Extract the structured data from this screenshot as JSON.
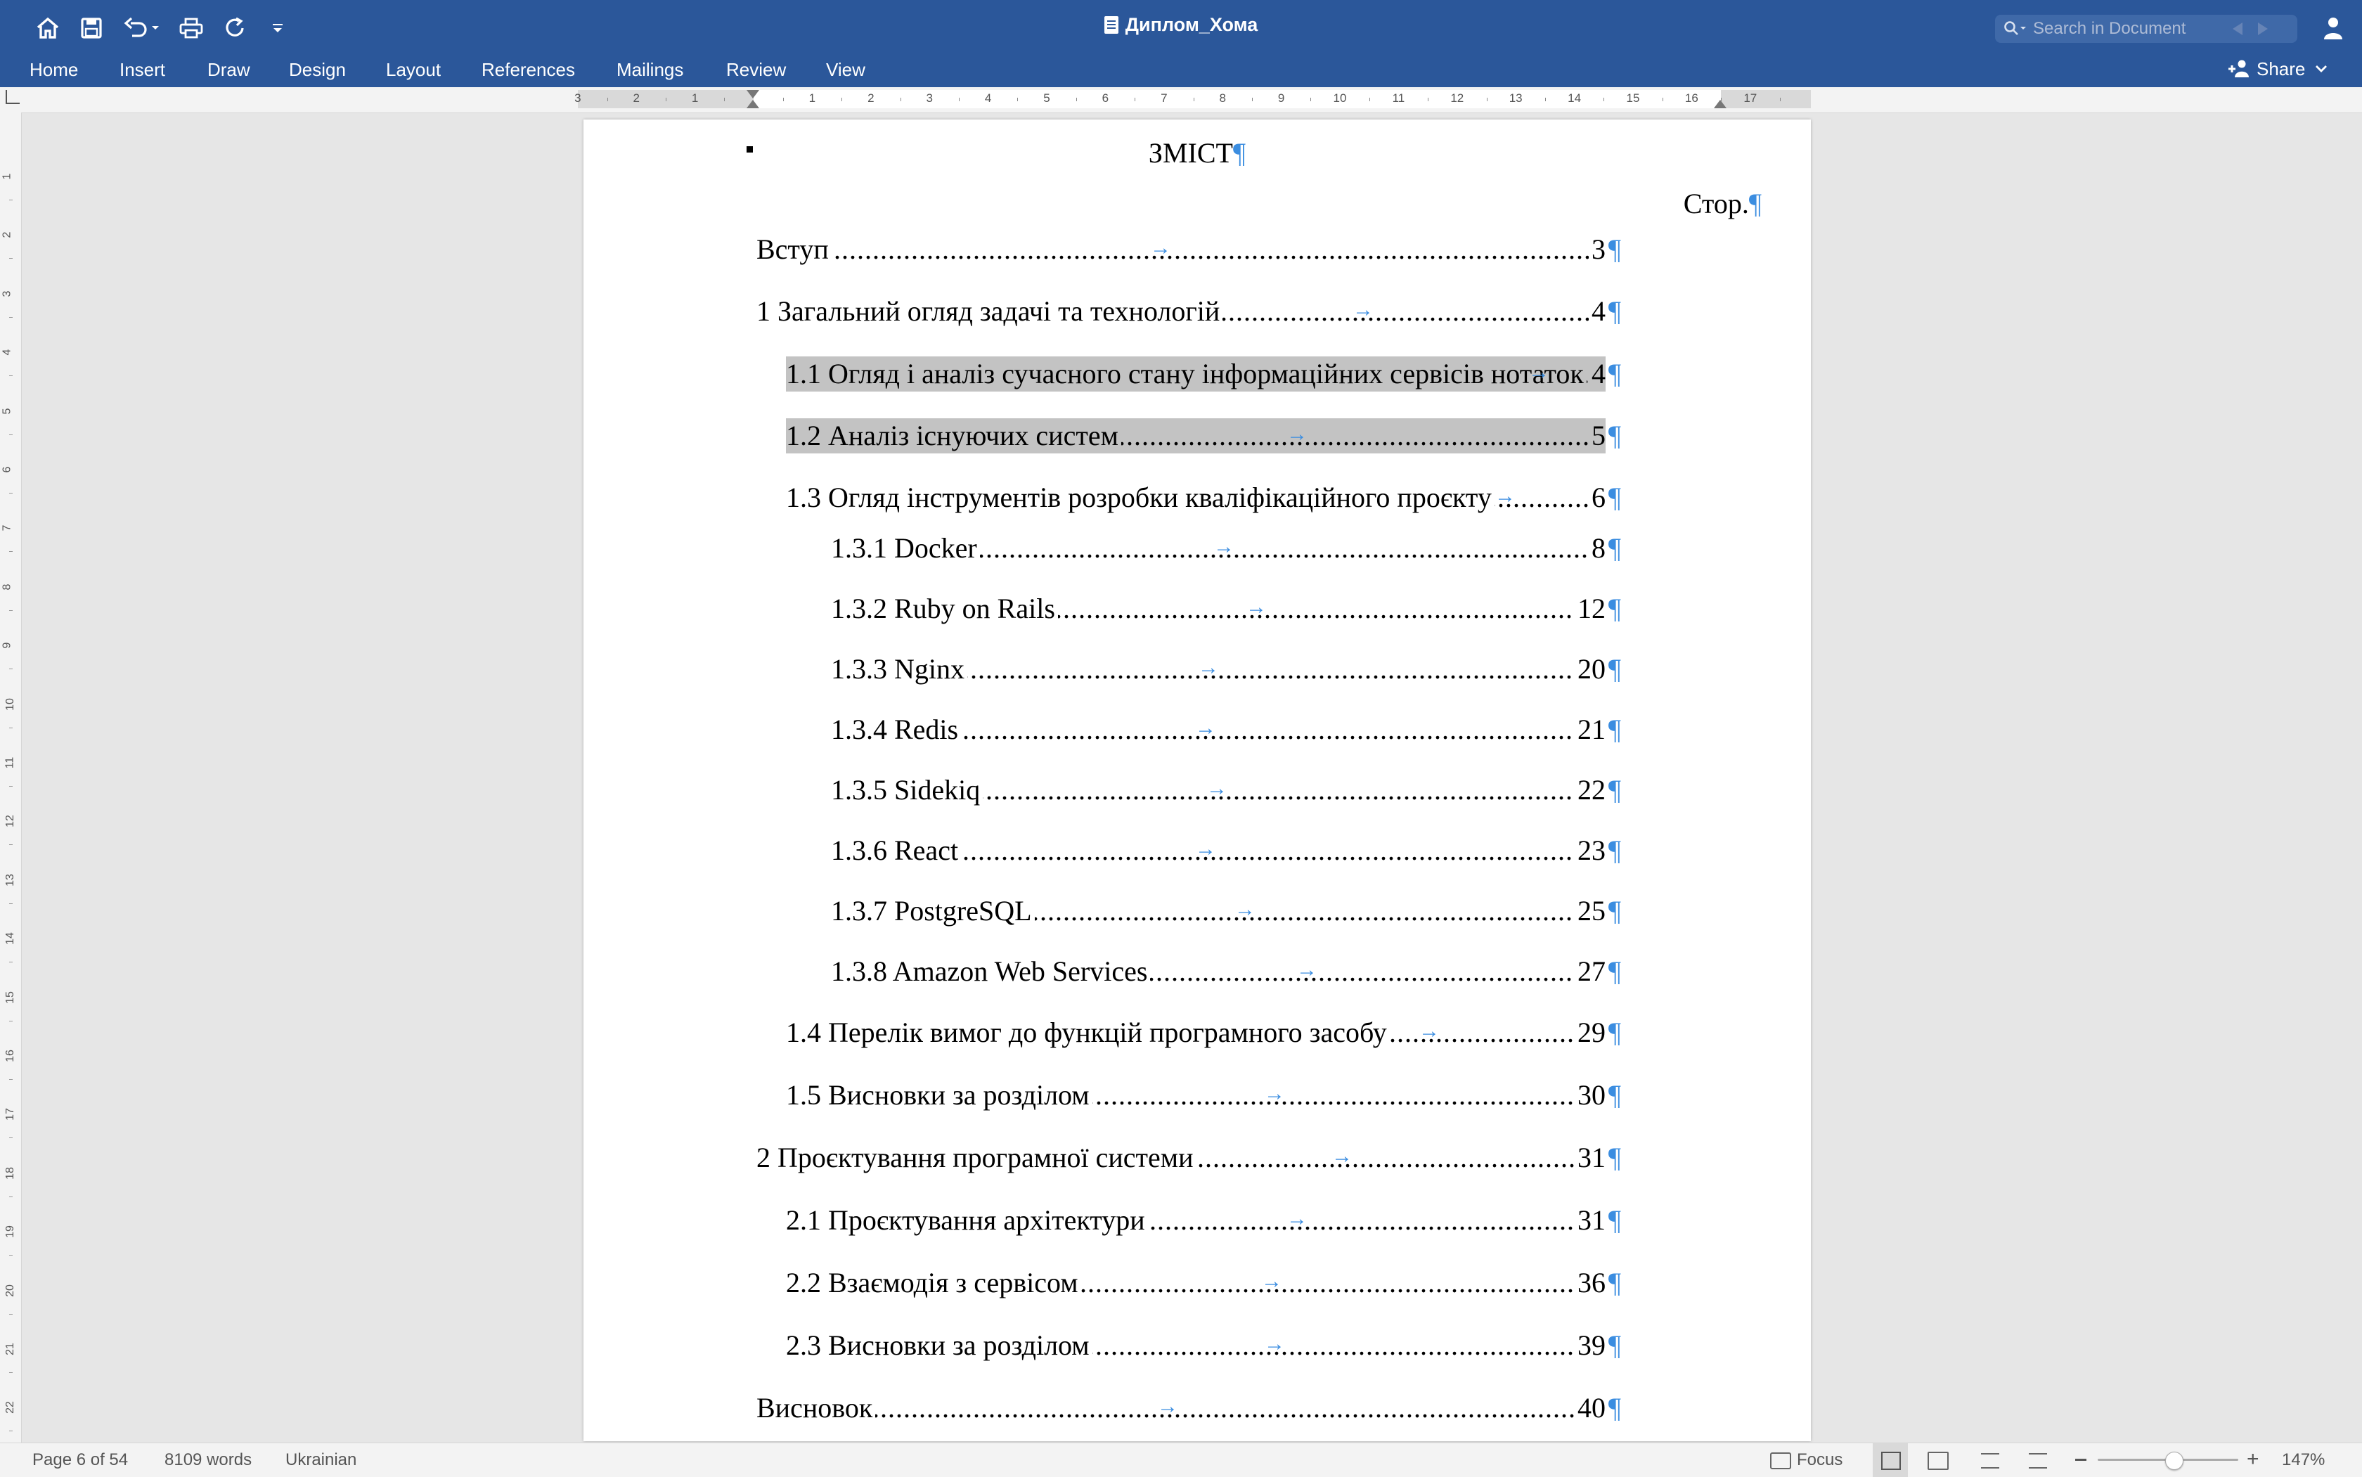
{
  "window": {
    "title": "Диплом_Хома"
  },
  "search": {
    "placeholder": "Search in Document"
  },
  "tabs": [
    {
      "label": "Home"
    },
    {
      "label": "Insert"
    },
    {
      "label": "Draw"
    },
    {
      "label": "Design"
    },
    {
      "label": "Layout"
    },
    {
      "label": "References"
    },
    {
      "label": "Mailings"
    },
    {
      "label": "Review"
    },
    {
      "label": "View"
    }
  ],
  "share": {
    "label": "Share"
  },
  "ruler": {
    "labels": [
      "3",
      "2",
      "1",
      "1",
      "2",
      "3",
      "4",
      "5",
      "6",
      "7",
      "8",
      "9",
      "10",
      "11",
      "12",
      "13",
      "14",
      "15",
      "16",
      "17"
    ]
  },
  "vruler": {
    "labels": [
      "1",
      "2",
      "3",
      "4",
      "5",
      "6",
      "7",
      "8",
      "9",
      "10",
      "11",
      "12",
      "13",
      "14",
      "15",
      "16",
      "17",
      "18",
      "19",
      "20",
      "21",
      "22"
    ]
  },
  "document": {
    "heading": "ЗМІСТ",
    "page_col_label": "Стор.",
    "pilcrow": "¶",
    "toc": [
      {
        "label": "Вступ",
        "page": "3"
      },
      {
        "label": "1 Загальний огляд задачі та технологій",
        "page": "4"
      },
      {
        "label": "1.1 Огляд і аналіз сучасного стану інформаційних сервісів нотаток",
        "page": "4"
      },
      {
        "label": "1.2 Аналіз існуючих систем",
        "page": "5"
      },
      {
        "label": "1.3 Огляд інструментів розробки кваліфікаційного проєкту",
        "page": "6"
      },
      {
        "label": "1.3.1 Docker",
        "page": "8"
      },
      {
        "label": "1.3.2 Ruby on Rails",
        "page": "12"
      },
      {
        "label": "1.3.3 Nginx",
        "page": "20"
      },
      {
        "label": "1.3.4 Redis",
        "page": "21"
      },
      {
        "label": "1.3.5 Sidekiq",
        "page": "22"
      },
      {
        "label": "1.3.6 React",
        "page": "23"
      },
      {
        "label": "1.3.7 PostgreSQL",
        "page": "25"
      },
      {
        "label": "1.3.8 Amazon Web Services",
        "page": "27"
      },
      {
        "label": "1.4 Перелік вимог до функцій програмного засобу",
        "page": "29"
      },
      {
        "label": "1.5 Висновки за розділом",
        "page": "30"
      },
      {
        "label": "2 Проєктування програмної системи",
        "page": "31"
      },
      {
        "label": "2.1 Проєктування архітектури",
        "page": "31"
      },
      {
        "label": "2.2 Взаємодія з сервісом",
        "page": "36"
      },
      {
        "label": "2.3 Висновки за розділом",
        "page": "39"
      },
      {
        "label": "Висновок",
        "page": "40"
      }
    ]
  },
  "status": {
    "page_info": "Page 6 of 54",
    "word_count": "8109 words",
    "language": "Ukrainian",
    "focus_label": "Focus",
    "zoom": "147%"
  },
  "colors": {
    "ribbon": "#2b579a",
    "formatting_marks": "#3b8de0",
    "highlight": "#c3c3c3"
  }
}
